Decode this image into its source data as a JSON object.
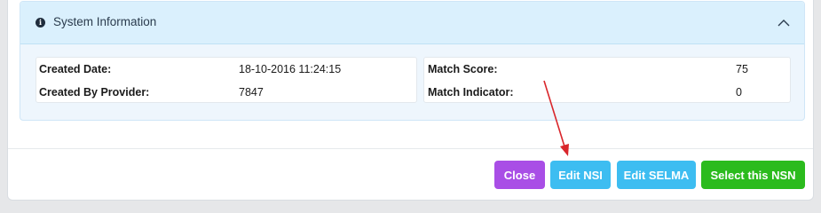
{
  "panel": {
    "title": "System Information",
    "info_icon_glyph": "i",
    "collapse_icon": "chevron-up-icon"
  },
  "left_fields": [
    {
      "label": "Created Date:",
      "value": "18-10-2016 11:24:15"
    },
    {
      "label": "Created By Provider:",
      "value": "7847"
    }
  ],
  "right_fields": [
    {
      "label": "Match Score:",
      "value": "75"
    },
    {
      "label": "Match Indicator:",
      "value": "0"
    }
  ],
  "buttons": {
    "close": "Close",
    "edit_nsi": "Edit NSI",
    "edit_selma": "Edit SELMA",
    "select_nsn": "Select this NSN"
  },
  "colors": {
    "close": "#a94ee6",
    "edit": "#3dbdf1",
    "select": "#2bbb1d",
    "annotation_arrow": "#d9262b"
  }
}
